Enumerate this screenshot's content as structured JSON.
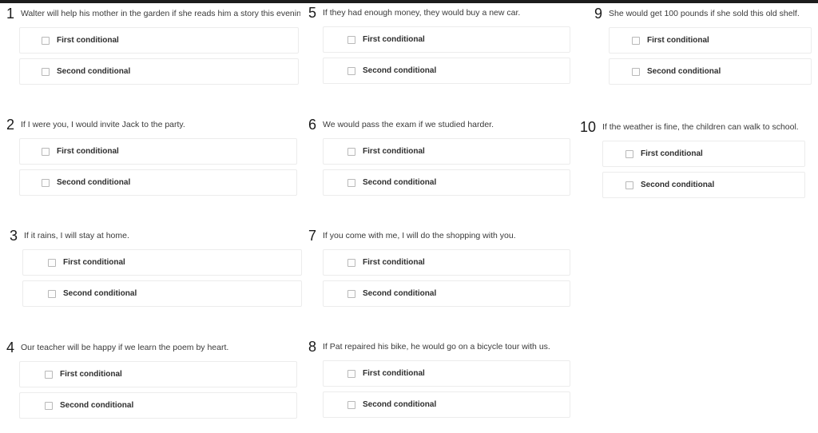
{
  "page": {
    "background_color": "#ffffff",
    "top_bar_color": "#1d1d1d",
    "option_border_color": "#ececec",
    "checkbox_border_color": "#b9b9b9",
    "text_color": "#3a3a3a"
  },
  "options_labels": {
    "first": "First conditional",
    "second": "Second conditional",
    "checkbox_icon": "empty-checkbox-icon"
  },
  "questions": [
    {
      "number": "1",
      "sentence": "Walter will help his mother in the garden if she reads him a story this evening.",
      "options": [
        {
          "label": "First conditional",
          "checked": false
        },
        {
          "label": "Second conditional",
          "checked": false
        }
      ]
    },
    {
      "number": "2",
      "sentence": "If I were you, I would invite Jack to the party.",
      "options": [
        {
          "label": "First conditional",
          "checked": false
        },
        {
          "label": "Second conditional",
          "checked": false
        }
      ]
    },
    {
      "number": "3",
      "sentence": "If it rains, I will stay at home.",
      "options": [
        {
          "label": "First conditional",
          "checked": false
        },
        {
          "label": "Second conditional",
          "checked": false
        }
      ]
    },
    {
      "number": "4",
      "sentence": "Our teacher will be happy if we learn the poem by heart.",
      "options": [
        {
          "label": "First conditional",
          "checked": false
        },
        {
          "label": "Second conditional",
          "checked": false
        }
      ]
    },
    {
      "number": "5",
      "sentence": "If they had enough money, they would buy a new car.",
      "options": [
        {
          "label": "First conditional",
          "checked": false
        },
        {
          "label": "Second conditional",
          "checked": false
        }
      ]
    },
    {
      "number": "6",
      "sentence": "We would pass the exam if we studied harder.",
      "options": [
        {
          "label": "First conditional",
          "checked": false
        },
        {
          "label": "Second conditional",
          "checked": false
        }
      ]
    },
    {
      "number": "7",
      "sentence": "If you come with me, I will do the shopping with you.",
      "options": [
        {
          "label": "First conditional",
          "checked": false
        },
        {
          "label": "Second conditional",
          "checked": false
        }
      ]
    },
    {
      "number": "8",
      "sentence": "If Pat repaired his bike, he would go on a bicycle tour with us.",
      "options": [
        {
          "label": "First conditional",
          "checked": false
        },
        {
          "label": "Second conditional",
          "checked": false
        }
      ]
    },
    {
      "number": "9",
      "sentence": "She would get 100 pounds if she sold this old shelf.",
      "options": [
        {
          "label": "First conditional",
          "checked": false
        },
        {
          "label": "Second conditional",
          "checked": false
        }
      ]
    },
    {
      "number": "10",
      "sentence": "If the weather is fine, the children can walk to school.",
      "options": [
        {
          "label": "First conditional",
          "checked": false
        },
        {
          "label": "Second conditional",
          "checked": false
        }
      ]
    }
  ]
}
